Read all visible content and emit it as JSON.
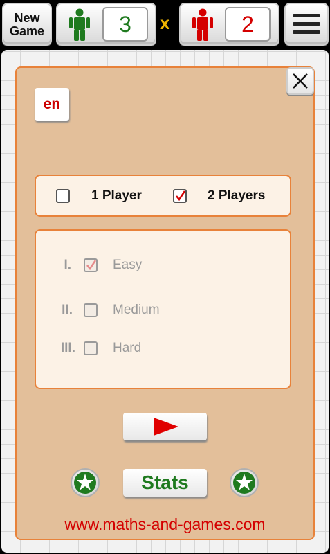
{
  "topbar": {
    "new_game_line1": "New",
    "new_game_line2": "Game",
    "score_player1": "3",
    "separator": "x",
    "score_player2": "2",
    "player1_color": "#1f7a1f",
    "player2_color": "#d40000",
    "player1_icon": "person-icon",
    "player2_icon": "person-icon",
    "menu_icon": "hamburger-menu-icon"
  },
  "settings": {
    "language": "en",
    "close_icon": "close-icon",
    "players": [
      {
        "label": "1 Player",
        "checked": false
      },
      {
        "label": "2 Players",
        "checked": true
      }
    ],
    "levels": [
      {
        "numeral": "I.",
        "label": "Easy",
        "checked": true
      },
      {
        "numeral": "II.",
        "label": "Medium",
        "checked": false
      },
      {
        "numeral": "III.",
        "label": "Hard",
        "checked": false
      }
    ],
    "play_icon": "play-icon",
    "stats_label": "Stats",
    "star_icon": "star-icon",
    "website": "www.maths-and-games.com"
  }
}
